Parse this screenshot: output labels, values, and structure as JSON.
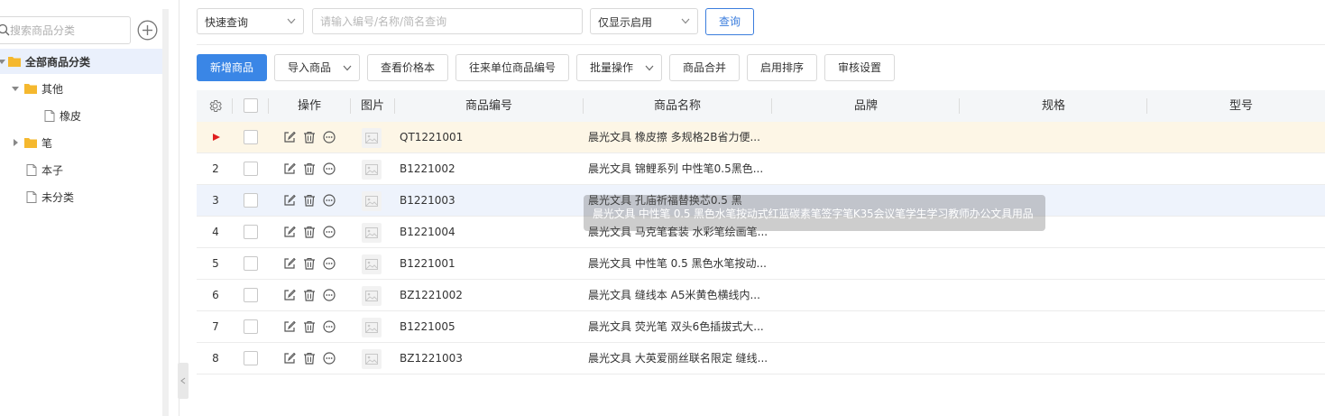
{
  "sidebar": {
    "search_placeholder": "搜索商品分类",
    "tree": [
      {
        "label": "全部商品分类"
      },
      {
        "label": "其他"
      },
      {
        "label": "橡皮"
      },
      {
        "label": "笔"
      },
      {
        "label": "本子"
      },
      {
        "label": "未分类"
      }
    ]
  },
  "filters": {
    "quick_query": "快速查询",
    "search_placeholder": "请输入编号/名称/简名查询",
    "status": "仅显示启用",
    "query_button": "查询"
  },
  "toolbar": {
    "add": "新增商品",
    "import": "导入商品",
    "price_book": "查看价格本",
    "partner_code": "往来单位商品编号",
    "batch": "批量操作",
    "merge": "商品合并",
    "sort": "启用排序",
    "audit": "审核设置"
  },
  "table": {
    "headers": {
      "ops": "操作",
      "image": "图片",
      "code": "商品编号",
      "name": "商品名称",
      "brand": "品牌",
      "spec": "规格",
      "model": "型号"
    },
    "rows": [
      {
        "index": "",
        "code": "QT1221001",
        "name": "晨光文具 橡皮擦 多规格2B省力便..."
      },
      {
        "index": "2",
        "code": "B1221002",
        "name": "晨光文具 锦鲤系列 中性笔0.5黑色..."
      },
      {
        "index": "3",
        "code": "B1221003",
        "name": "晨光文具 孔庙祈福替换芯0.5 黑"
      },
      {
        "index": "4",
        "code": "B1221004",
        "name": "晨光文具 马克笔套装 水彩笔绘画笔..."
      },
      {
        "index": "5",
        "code": "B1221001",
        "name": "晨光文具 中性笔 0.5 黑色水笔按动..."
      },
      {
        "index": "6",
        "code": "BZ1221002",
        "name": "晨光文具 缝线本 A5米黄色横线内..."
      },
      {
        "index": "7",
        "code": "B1221005",
        "name": "晨光文具 荧光笔 双头6色插拔式大..."
      },
      {
        "index": "8",
        "code": "BZ1221003",
        "name": "晨光文具 大英爱丽丝联名限定 缝线..."
      }
    ]
  },
  "tooltip": {
    "text": "晨光文具 中性笔 0.5 黑色水笔按动式红蓝碳素笔签字笔K35会议笔学生学习教师办公文具用品"
  },
  "colors": {
    "primary": "#3a86e6",
    "selected_row": "#fdf6e6",
    "hover_row": "#eef3fc",
    "folder": "#f5b82e",
    "marker": "#e02020"
  }
}
